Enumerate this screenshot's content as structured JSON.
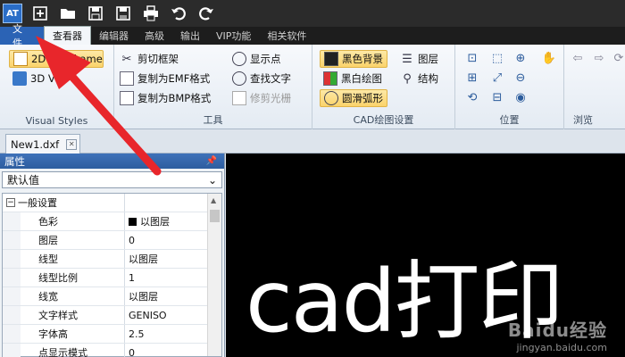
{
  "quick_access": {
    "app_icon": "app-logo-icon",
    "buttons": [
      "new-icon",
      "open-icon",
      "save-icon",
      "save-as-icon",
      "print-icon",
      "undo-icon",
      "redo-icon"
    ]
  },
  "tabs": [
    "文件",
    "查看器",
    "编辑器",
    "高级",
    "输出",
    "VIP功能",
    "相关软件"
  ],
  "ribbon": {
    "visual_styles": {
      "label": "Visual Styles",
      "wireframe_2d": "2D Wireframe",
      "view_3d": "3D Vi"
    },
    "tools": {
      "label": "工具",
      "clip_frame": "剪切框架",
      "copy_emf": "复制为EMF格式",
      "copy_bmp": "复制为BMP格式",
      "show_points": "显示点",
      "find_text": "查找文字",
      "trim_raster": "修剪光栅"
    },
    "cad_settings": {
      "label": "CAD绘图设置",
      "black_bg": "黑色背景",
      "bw_drawing": "黑白绘图",
      "smooth_arc": "圆滑弧形",
      "layers": "图层",
      "structure": "结构"
    },
    "position": {
      "label": "位置"
    },
    "browse": {
      "label": "浏览"
    }
  },
  "document_tab": "New1.dxf",
  "properties": {
    "title": "属性",
    "selector": "默认值",
    "category": "一般设置",
    "rows": [
      {
        "key": "色彩",
        "value": "以图层"
      },
      {
        "key": "图层",
        "value": "0"
      },
      {
        "key": "线型",
        "value": "以图层"
      },
      {
        "key": "线型比例",
        "value": "1"
      },
      {
        "key": "线宽",
        "value": "以图层"
      },
      {
        "key": "文字样式",
        "value": "GENISO"
      },
      {
        "key": "字体高",
        "value": "2.5"
      },
      {
        "key": "点显示模式",
        "value": "0"
      }
    ]
  },
  "canvas": {
    "text": "cad打印",
    "watermark_line1": "Baidu经验",
    "watermark_line2": "jingyan.baidu.com"
  },
  "colors": {
    "accent": "#2b63b5",
    "annotation_arrow": "#e8262b",
    "canvas_bg": "#000000"
  }
}
